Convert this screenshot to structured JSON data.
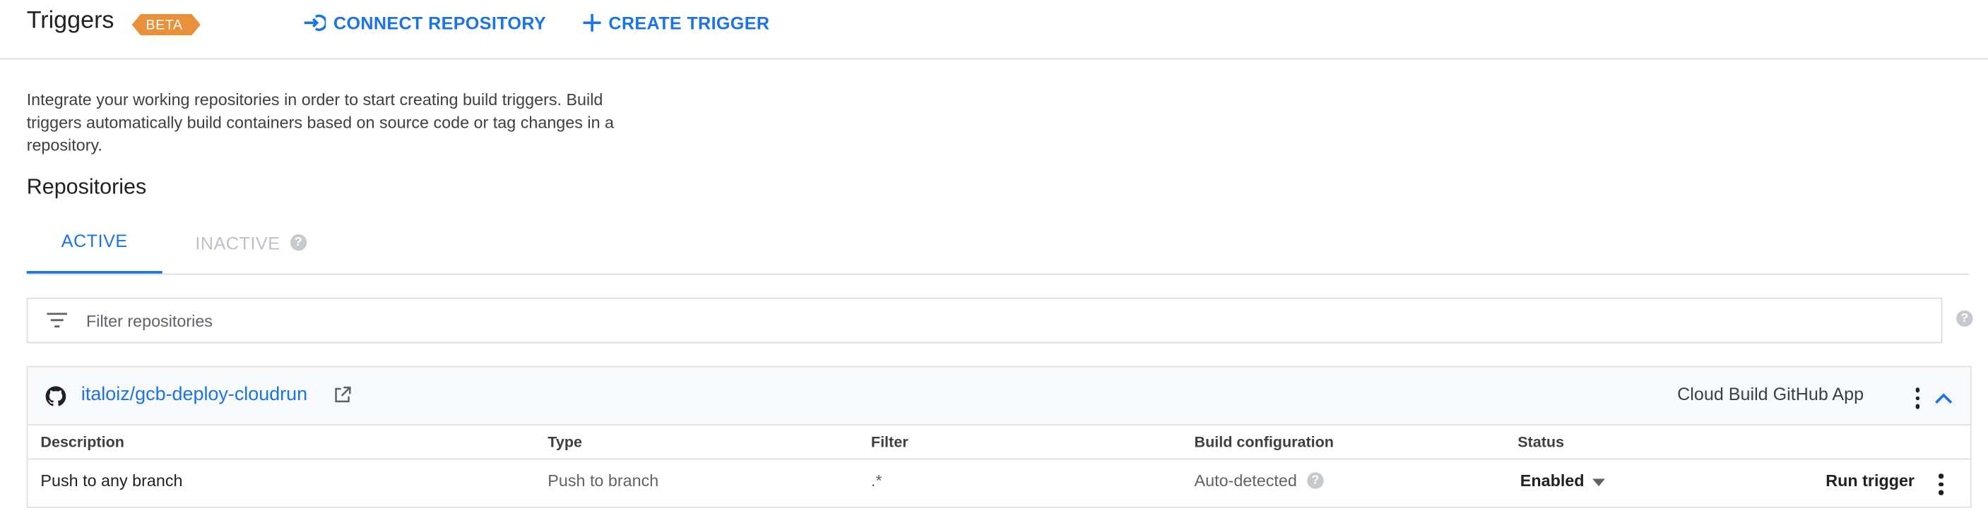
{
  "header": {
    "title": "Triggers",
    "badge": "BETA",
    "connect_label": "CONNECT REPOSITORY",
    "create_label": "CREATE TRIGGER"
  },
  "intro": "Integrate your working repositories in order to start creating build triggers. Build triggers automatically build containers based on source code or tag changes in a repository.",
  "section_title": "Repositories",
  "tabs": [
    {
      "label": "ACTIVE",
      "selected": true
    },
    {
      "label": "INACTIVE",
      "selected": false
    }
  ],
  "filter": {
    "placeholder": "Filter repositories",
    "value": ""
  },
  "repository": {
    "name": "italoiz/gcb-deploy-cloudrun",
    "app": "Cloud Build GitHub App",
    "columns": [
      "Description",
      "Type",
      "Filter",
      "Build configuration",
      "Status"
    ],
    "rows": [
      {
        "description": "Push to any branch",
        "type": "Push to branch",
        "filter": ".*",
        "build_config": "Auto-detected",
        "status": "Enabled",
        "action": "Run trigger"
      }
    ]
  },
  "colors": {
    "accent": "#1a73e8",
    "badge": "#e8913a",
    "border": "#dadce0"
  },
  "icons": [
    "connect-icon",
    "plus-icon",
    "help-icon",
    "filter-icon",
    "github-icon",
    "external-link-icon",
    "more-vert-icon",
    "chevron-up-icon",
    "dropdown-arrow-icon"
  ]
}
